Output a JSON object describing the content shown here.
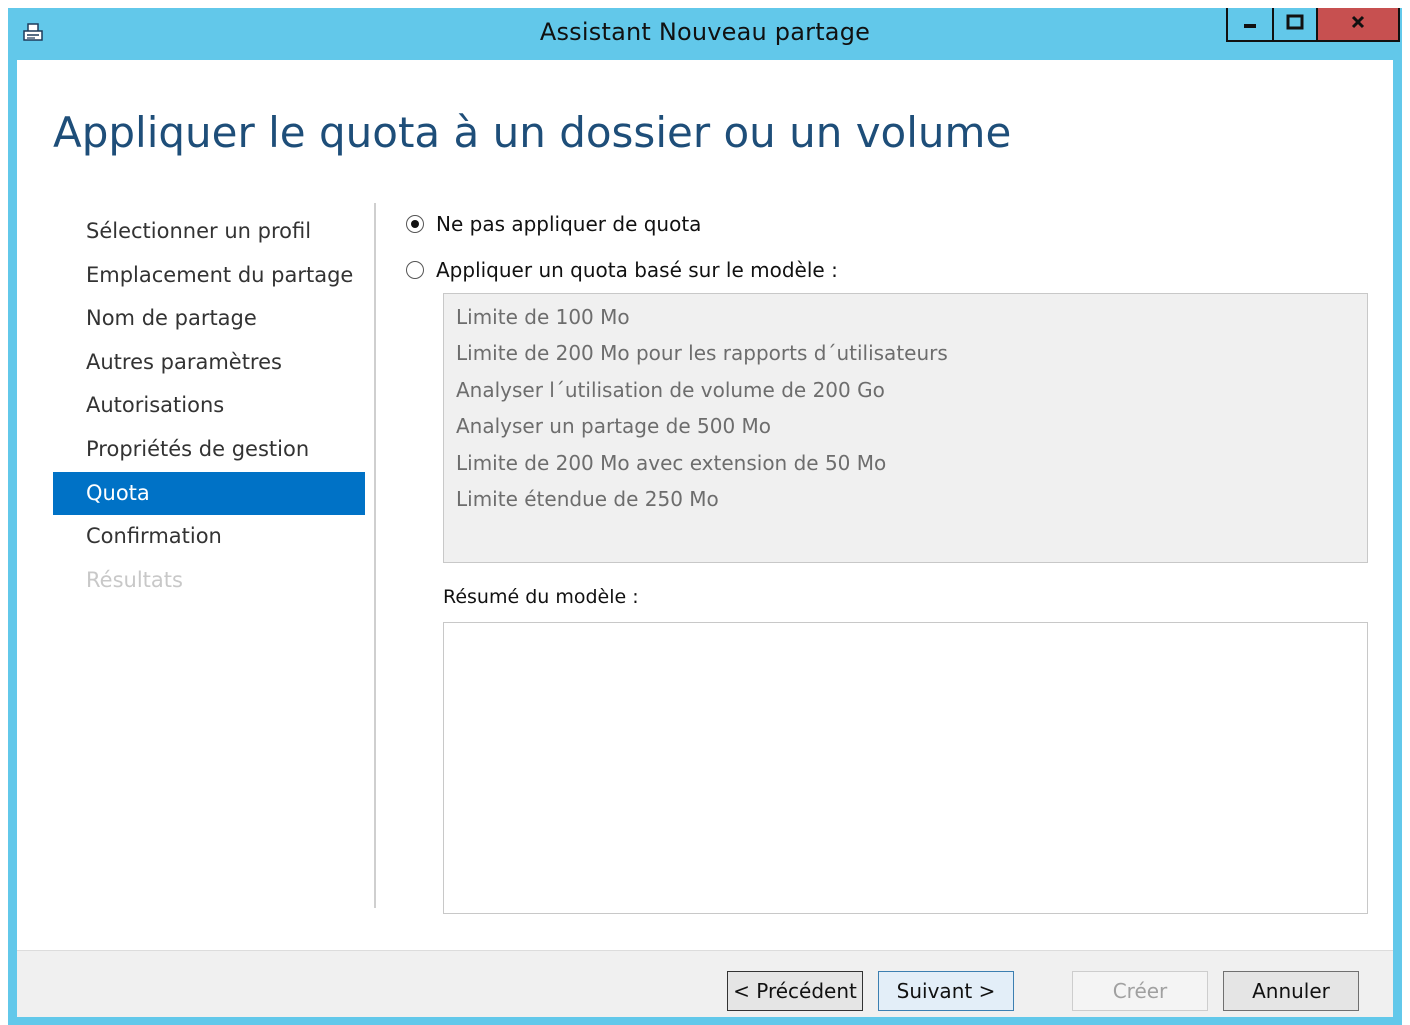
{
  "window": {
    "title": "Assistant Nouveau partage",
    "icons": {
      "app": "share-wizard-icon",
      "minimize": "minimize-icon",
      "maximize": "maximize-icon",
      "close": "close-icon"
    },
    "colors": {
      "titlebar": "#62c8ea",
      "close": "#c75050",
      "accent": "#0072c6",
      "heading": "#1e4e79"
    }
  },
  "page": {
    "title": "Appliquer le quota à un dossier ou un volume"
  },
  "nav": {
    "items": [
      {
        "label": "Sélectionner un profil",
        "state": "normal"
      },
      {
        "label": "Emplacement du partage",
        "state": "normal"
      },
      {
        "label": "Nom de partage",
        "state": "normal"
      },
      {
        "label": "Autres paramètres",
        "state": "normal"
      },
      {
        "label": "Autorisations",
        "state": "normal"
      },
      {
        "label": "Propriétés de gestion",
        "state": "normal"
      },
      {
        "label": "Quota",
        "state": "active"
      },
      {
        "label": "Confirmation",
        "state": "normal"
      },
      {
        "label": "Résultats",
        "state": "disabled"
      }
    ]
  },
  "options": {
    "no_quota": {
      "label": "Ne pas appliquer de quota",
      "checked": true
    },
    "template_quota": {
      "label": "Appliquer un quota basé sur le modèle :",
      "checked": false
    }
  },
  "templates": [
    "Limite de 100 Mo",
    "Limite de 200 Mo pour les rapports d´utilisateurs",
    "Analyser l´utilisation de volume de 200 Go",
    "Analyser un partage de 500 Mo",
    "Limite de 200 Mo avec extension de 50 Mo",
    "Limite étendue de 250 Mo"
  ],
  "summary": {
    "label": "Résumé du modèle :",
    "content": ""
  },
  "footer": {
    "previous": "< Précédent",
    "next": "Suivant >",
    "create": "Créer",
    "cancel": "Annuler"
  }
}
